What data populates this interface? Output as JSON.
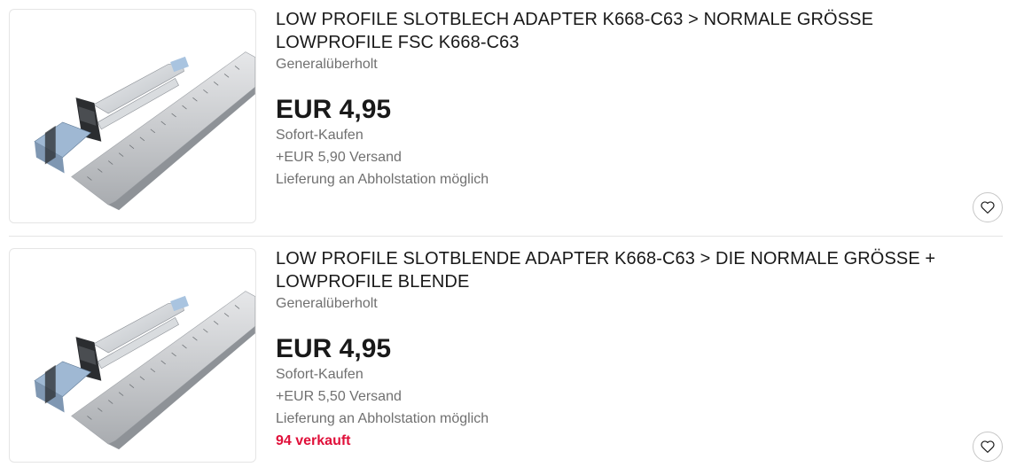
{
  "listings": [
    {
      "title": "LOW PROFILE SLOTBLECH ADAPTER K668-C63 > NORMALE GRÖSSE LOWPROFILE FSC K668-C63",
      "condition": "Generalüberholt",
      "price": "EUR 4,95",
      "buy_format": "Sofort-Kaufen",
      "shipping": "+EUR 5,90 Versand",
      "pickup": "Lieferung an Abholstation möglich",
      "sold": "",
      "watch_icon": "heart-outline-icon"
    },
    {
      "title": "LOW PROFILE SLOTBLENDE ADAPTER K668-C63 > DIE NORMALE GRÖSSE + LOWPROFILE BLENDE",
      "condition": "Generalüberholt",
      "price": "EUR 4,95",
      "buy_format": "Sofort-Kaufen",
      "shipping": "+EUR 5,50 Versand",
      "pickup": "Lieferung an Abholstation möglich",
      "sold": "94 verkauft",
      "watch_icon": "heart-outline-icon"
    }
  ],
  "colors": {
    "text": "#191919",
    "secondary_text": "#707070",
    "sold_red": "#e0103a",
    "divider": "#e5e5e5"
  }
}
